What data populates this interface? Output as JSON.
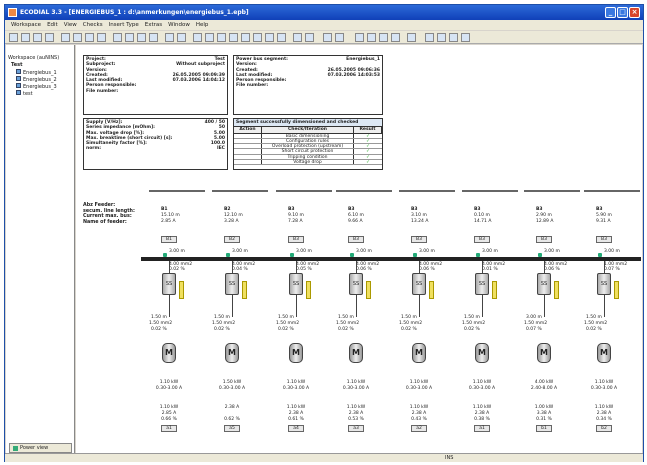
{
  "window": {
    "title": "ECODIAL 3.3 - [ENERGIEBUS_1 : d:\\anmerkungen\\energiebus_1.epb]"
  },
  "menu": [
    "Workspace",
    "Edit",
    "View",
    "Checks",
    "Insert Type",
    "Extras",
    "Window",
    "Help"
  ],
  "tree": {
    "root": "Workspace (auNINS)",
    "project": "Test",
    "items": [
      "Energiebus_1",
      "Energiebus_2",
      "Energiebus_3",
      "test"
    ]
  },
  "plan_view": "Power view",
  "project_box": {
    "rows": [
      [
        "Project:",
        "Test"
      ],
      [
        "Subproject:",
        "Without subproject"
      ],
      [
        "Version:",
        ""
      ],
      [
        "Created:",
        "26.05.2005 09:09:39"
      ],
      [
        "Last modified:",
        "07.03.2006 14:04:12"
      ],
      [
        "Person responsible:",
        ""
      ],
      [
        "File number:",
        ""
      ]
    ]
  },
  "bus_box": {
    "rows": [
      [
        "Power bus segment:",
        "Energiebus_1"
      ],
      [
        "Version:",
        ""
      ],
      [
        "Created:",
        "26.05.2005 09:06:36"
      ],
      [
        "Last modified:",
        "07.03.2006 14:03:53"
      ],
      [
        "Person responsible:",
        ""
      ],
      [
        "File number:",
        ""
      ]
    ]
  },
  "supply_box": {
    "rows": [
      [
        "Supply [V/Hz]:",
        "400 / 50"
      ],
      [
        "Series impedance [mOhm]:",
        "50"
      ],
      [
        "Max. voltage drop [%]:",
        "5.00"
      ],
      [
        "Max. breaktime (short circuit) [s]:",
        "5.00"
      ],
      [
        "Simultaneity factor [%]:",
        "100.0"
      ],
      [
        "norm:",
        "IEC"
      ]
    ]
  },
  "check": {
    "title": "Segment successfully dimensioned and checked",
    "headers": [
      "Action",
      "Check/Iteration",
      "Result"
    ],
    "rows": [
      "Basic dimensioning",
      "Configuration rules",
      "Overload protection (upstream)",
      "Short circuit protection",
      "Tripping condition",
      "Voltage drop"
    ],
    "ok": "✓"
  },
  "feeder_labels": [
    "Abz Feeder:",
    "secum. line length:",
    "Current max. bus:",
    "Name of feeder:"
  ],
  "feeders": [
    {
      "id": "B1",
      "len": "15.10 m",
      "cur": "2.85 A",
      "btn": "B1"
    },
    {
      "id": "B2",
      "len": "12.10 m",
      "cur": "3.28 A",
      "btn": "B2"
    },
    {
      "id": "B3",
      "len": "9.10 m",
      "cur": "7.28 A",
      "btn": "B3"
    },
    {
      "id": "B3",
      "len": "6.10 m",
      "cur": "9.66 A",
      "btn": "B3"
    },
    {
      "id": "B3",
      "len": "3.10 m",
      "cur": "13.24 A",
      "btn": "B3"
    },
    {
      "id": "B3",
      "len": "0.10 m",
      "cur": "14.71 A",
      "btn": "B3"
    },
    {
      "id": "B3",
      "len": "2.90 m",
      "cur": "12.89 A",
      "btn": "B3"
    },
    {
      "id": "B3",
      "len": "5.90 m",
      "cur": "9.31 A",
      "btn": "B3"
    }
  ],
  "segments": [
    {
      "top": "3.00 m",
      "mid": "4.00 mm2",
      "bot": "0.02 %"
    },
    {
      "top": "3.00 m",
      "mid": "4.00 mm2",
      "bot": "0.04 %"
    },
    {
      "top": "3.00 m",
      "mid": "4.00 mm2",
      "bot": "0.05 %"
    },
    {
      "top": "3.00 m",
      "mid": "4.00 mm2",
      "bot": "0.06 %"
    },
    {
      "top": "3.00 m",
      "mid": "4.00 mm2",
      "bot": "0.06 %"
    },
    {
      "top": "3.00 m",
      "mid": "4.00 mm2",
      "bot": "0.01 %"
    },
    {
      "top": "3.00 m",
      "mid": "4.00 mm2",
      "bot": "0.06 %"
    },
    {
      "top": "3.00 m",
      "mid": "1.00 mm2",
      "bot": "0.07 %"
    }
  ],
  "ss": "SS",
  "fuse": "Ecofuse",
  "branches": [
    {
      "l1": "1.50 m",
      "l2": "1.50 mm2",
      "l3": "0.02 %",
      "m1": "1.10 kW",
      "m2": "0.30-3.00 A",
      "n1": "1.10 kW",
      "n2": "2.85 A",
      "n3": "0.66 %",
      "b": "a1"
    },
    {
      "l1": "1.50 m",
      "l2": "1.50 mm2",
      "l3": "0.02 %",
      "m1": "1.50 kW",
      "m2": "0.30-3.00 A",
      "n1": "2.38 A",
      "n2": "",
      "n3": "0.62 %",
      "b": "a5"
    },
    {
      "l1": "1.50 m",
      "l2": "1.50 mm2",
      "l3": "0.02 %",
      "m1": "1.10 kW",
      "m2": "0.30-3.00 A",
      "n1": "1.10 kW",
      "n2": "2.38 A",
      "n3": "0.61 %",
      "b": "a4"
    },
    {
      "l1": "1.50 m",
      "l2": "1.50 mm2",
      "l3": "0.02 %",
      "m1": "1.10 kW",
      "m2": "0.30-3.00 A",
      "n1": "1.10 kW",
      "n2": "2.38 A",
      "n3": "0.53 %",
      "b": "a3"
    },
    {
      "l1": "1.50 m",
      "l2": "1.50 mm2",
      "l3": "0.02 %",
      "m1": "1.10 kW",
      "m2": "0.30-3.00 A",
      "n1": "1.10 kW",
      "n2": "2.38 A",
      "n3": "0.43 %",
      "b": "a2"
    },
    {
      "l1": "1.50 m",
      "l2": "1.50 mm2",
      "l3": "0.02 %",
      "m1": "1.10 kW",
      "m2": "0.30-3.00 A",
      "n1": "1.10 kW",
      "n2": "2.38 A",
      "n3": "0.38 %",
      "b": "a1"
    },
    {
      "l1": "3.00 m",
      "l2": "1.50 mm2",
      "l3": "0.07 %",
      "m1": "4.00 kW",
      "m2": "2.40-8.00 A",
      "n1": "1.00 kW",
      "n2": "3.38 A",
      "n3": "0.31 %",
      "b": "b1"
    },
    {
      "l1": "1.50 m",
      "l2": "1.50 mm2",
      "l3": "0.02 %",
      "m1": "1.10 kW",
      "m2": "0.30-3.00 A",
      "n1": "1.10 kW",
      "n2": "2.38 A",
      "n3": "0.34 %",
      "b": "b2"
    }
  ],
  "status": {
    "zoom": "INS"
  }
}
